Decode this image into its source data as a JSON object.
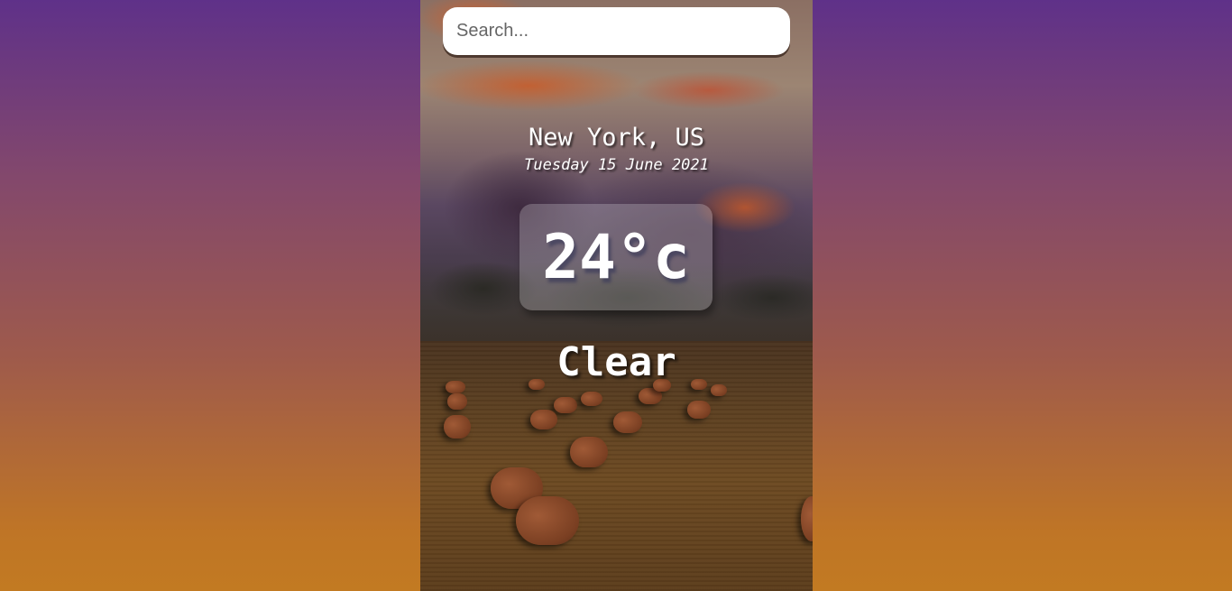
{
  "search": {
    "placeholder": "Search...",
    "value": ""
  },
  "weather": {
    "location": "New York, US",
    "date": "Tuesday 15 June 2021",
    "temperature": "24°c",
    "condition": "Clear"
  }
}
